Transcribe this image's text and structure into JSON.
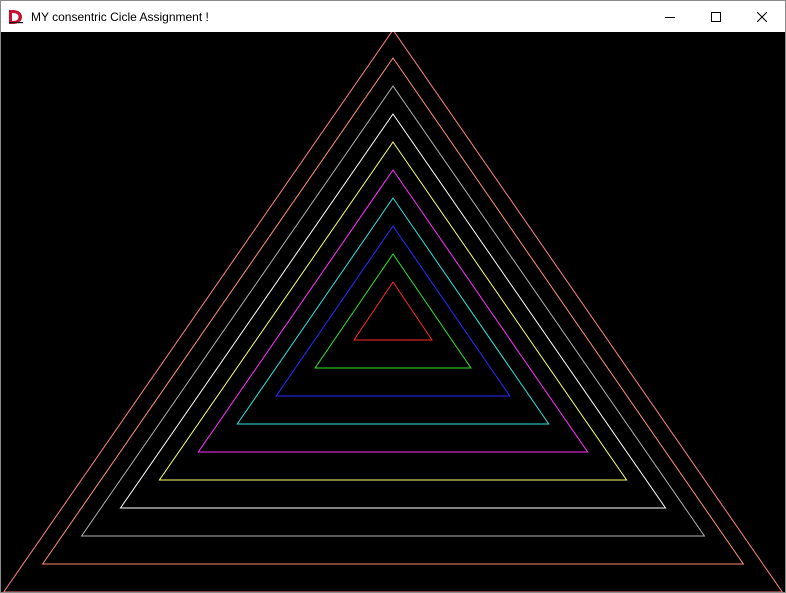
{
  "window": {
    "title": "MY consentric Cicle Assignment !",
    "icon": "app-logo-icon",
    "controls": {
      "minimize_icon": "minimize-icon",
      "maximize_icon": "maximize-icon",
      "close_icon": "close-icon"
    }
  },
  "canvas": {
    "background": "#000000",
    "triangles": [
      {
        "color": "#ff2a2a"
      },
      {
        "color": "#32e032"
      },
      {
        "color": "#2a2aff"
      },
      {
        "color": "#30e0e0"
      },
      {
        "color": "#ff30ff"
      },
      {
        "color": "#ffff70"
      },
      {
        "color": "#ffffff"
      },
      {
        "color": "#b0b0b0"
      },
      {
        "color": "#ff9070"
      },
      {
        "color": "#ff8080"
      }
    ]
  }
}
